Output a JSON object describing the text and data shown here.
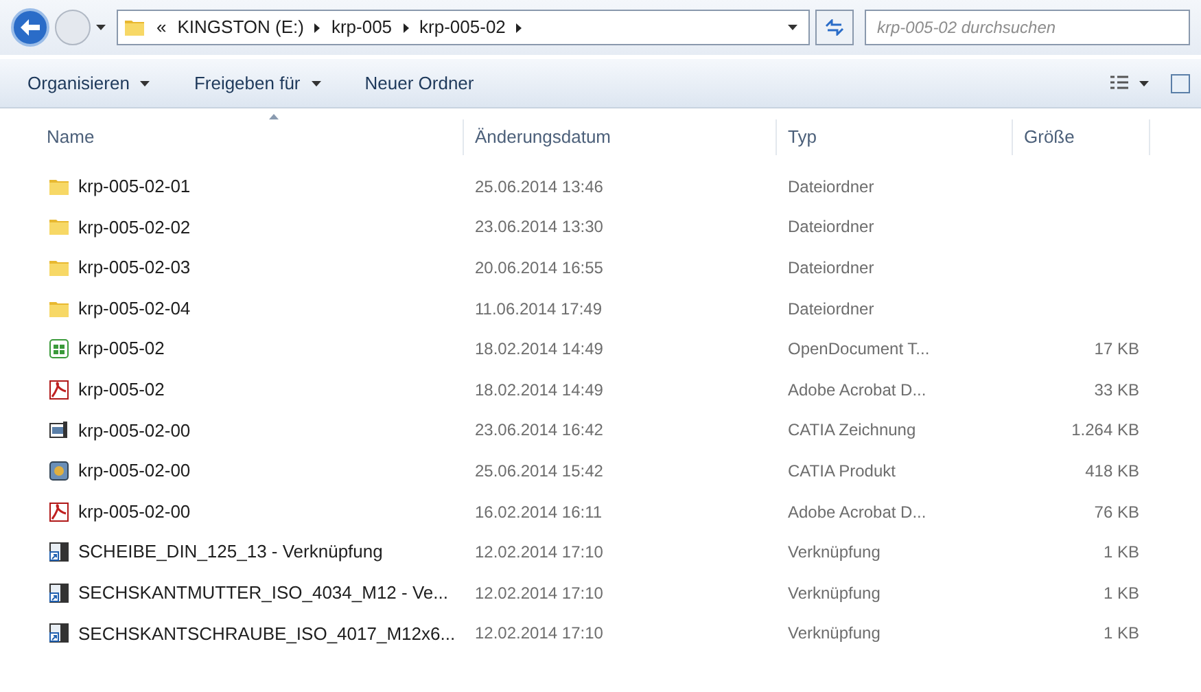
{
  "address_bar": {
    "overflow": "«",
    "crumbs": [
      "KINGSTON (E:)",
      "krp-005",
      "krp-005-02"
    ]
  },
  "search": {
    "placeholder": "krp-005-02 durchsuchen"
  },
  "toolbar": {
    "buttons": [
      {
        "label": "Organisieren",
        "dropdown": true
      },
      {
        "label": "Freigeben für",
        "dropdown": true
      },
      {
        "label": "Neuer Ordner",
        "dropdown": false
      }
    ]
  },
  "table": {
    "columns": [
      {
        "label": "Name",
        "sorted": true
      },
      {
        "label": "Änderungsdatum",
        "sorted": false
      },
      {
        "label": "Typ",
        "sorted": false
      },
      {
        "label": "Größe",
        "sorted": false
      }
    ],
    "rows": [
      {
        "kind": "folder",
        "name": "krp-005-02-01",
        "date": "25.06.2014 13:46",
        "type": "Dateiordner"
      },
      {
        "kind": "folder",
        "name": "krp-005-02-02",
        "date": "23.06.2014 13:30",
        "type": "Dateiordner"
      },
      {
        "kind": "folder",
        "name": "krp-005-02-03",
        "date": "20.06.2014 16:55",
        "type": "Dateiordner"
      },
      {
        "kind": "folder",
        "name": "krp-005-02-04",
        "date": "11.06.2014 17:49",
        "type": "Dateiordner"
      },
      {
        "kind": "spreadsheet",
        "name": "krp-005-02",
        "date": "18.02.2014 14:49",
        "type": "OpenDocument T...",
        "size": "17 KB"
      },
      {
        "kind": "pdf",
        "name": "krp-005-02",
        "date": "18.02.2014 14:49",
        "type": "Adobe Acrobat D...",
        "size": "33 KB"
      },
      {
        "kind": "drawing",
        "name": "krp-005-02-00",
        "date": "23.06.2014 16:42",
        "type": "CATIA Zeichnung",
        "size": "1.264 KB"
      },
      {
        "kind": "product",
        "name": "krp-005-02-00",
        "date": "25.06.2014 15:42",
        "type": "CATIA Produkt",
        "size": "418 KB"
      },
      {
        "kind": "pdf",
        "name": "krp-005-02-00",
        "date": "16.02.2014 16:11",
        "type": "Adobe Acrobat D...",
        "size": "76 KB"
      },
      {
        "kind": "shortcut",
        "name": "SCHEIBE_DIN_125_13 - Verknüpfung",
        "date": "12.02.2014 17:10",
        "type": "Verknüpfung",
        "size": "1 KB"
      },
      {
        "kind": "shortcut",
        "name": "SECHSKANTMUTTER_ISO_4034_M12 - Ve...",
        "date": "12.02.2014 17:10",
        "type": "Verknüpfung",
        "size": "1 KB"
      },
      {
        "kind": "shortcut",
        "name": "SECHSKANTSCHRAUBE_ISO_4017_M12x6...",
        "date": "12.02.2014 17:10",
        "type": "Verknüpfung",
        "size": "1 KB"
      }
    ]
  }
}
